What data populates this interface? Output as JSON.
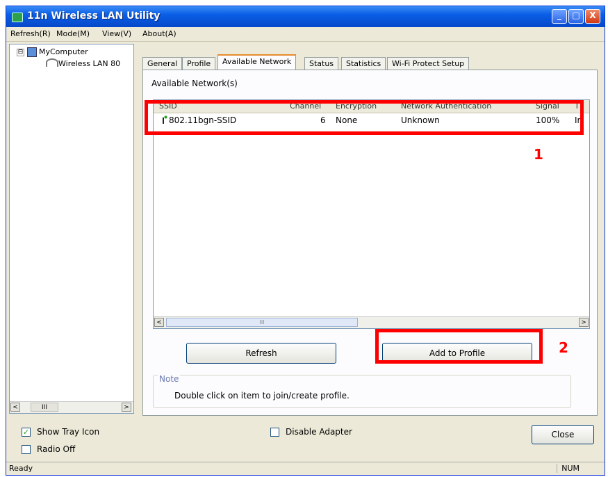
{
  "window": {
    "title": "11n Wireless LAN Utility",
    "minimize": "_",
    "maximize": "□",
    "close": "X"
  },
  "menu": [
    "Refresh(R)",
    "Mode(M)",
    "View(V)",
    "About(A)"
  ],
  "tree": {
    "expander": "⊟",
    "root": "MyComputer",
    "child": "Wireless LAN 80",
    "scroll_left": "<",
    "scroll_mid": "III",
    "scroll_right": ">"
  },
  "tabs": [
    "General",
    "Profile",
    "Available Network",
    "Status",
    "Statistics",
    "Wi-Fi Protect Setup"
  ],
  "panel": {
    "label": "Available Network(s)",
    "columns": [
      "SSID",
      "Channel",
      "Encryption",
      "Network Authentication",
      "Signal",
      "T"
    ],
    "rows": [
      {
        "ssid": "802.11bgn-SSID",
        "channel": "6",
        "encryption": "None",
        "auth": "Unknown",
        "signal": "100%",
        "type": "Ir"
      }
    ],
    "scroll_left": "<",
    "scroll_mid": "III",
    "scroll_right": ">"
  },
  "buttons": {
    "refresh": "Refresh",
    "add_profile": "Add to Profile",
    "close": "Close"
  },
  "note": {
    "label": "Note",
    "text": "Double click on item to join/create profile."
  },
  "annotations": {
    "one": "1",
    "two": "2"
  },
  "options": {
    "show_tray_icon": {
      "label": "Show Tray Icon",
      "checked": true,
      "mark": "✓"
    },
    "radio_off": {
      "label": "Radio Off",
      "checked": false
    },
    "disable_adapter": {
      "label": "Disable Adapter",
      "checked": false
    }
  },
  "status": {
    "text": "Ready",
    "num": "NUM"
  },
  "colors": {
    "annotation": "#ff0000",
    "titlebar": "#0a5ee6",
    "tab_accent": "#e68b2c"
  }
}
